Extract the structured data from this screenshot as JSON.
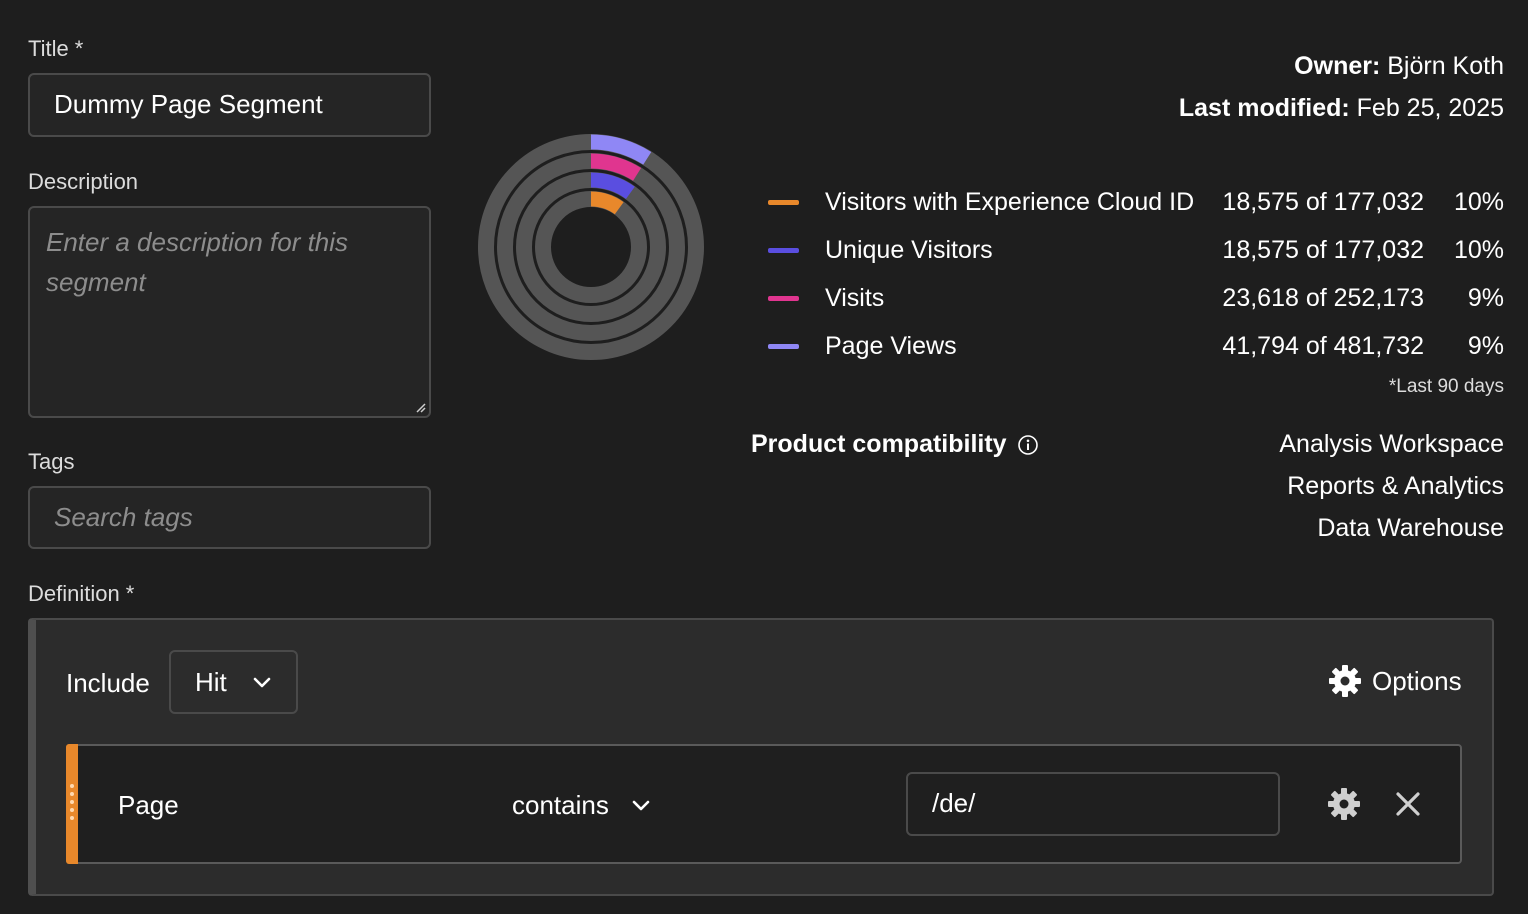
{
  "form": {
    "title_label": "Title",
    "required_mark": "*",
    "title_value": "Dummy Page Segment",
    "description_label": "Description",
    "description_placeholder": "Enter a description for this segment",
    "tags_label": "Tags",
    "tags_placeholder": "Search tags",
    "definition_label": "Definition"
  },
  "meta": {
    "owner_label": "Owner:",
    "owner_value": "Björn Koth",
    "modified_label": "Last modified:",
    "modified_value": "Feb 25, 2025"
  },
  "stats": {
    "rows": [
      {
        "name": "Visitors with Experience Cloud ID",
        "count": "18,575 of 177,032",
        "pct": "10%",
        "color": "#e8882b",
        "fraction": 0.1
      },
      {
        "name": "Unique Visitors",
        "count": "18,575 of 177,032",
        "pct": "10%",
        "color": "#5a4ee0",
        "fraction": 0.1
      },
      {
        "name": "Visits",
        "count": "23,618 of 252,173",
        "pct": "9%",
        "color": "#e0358f",
        "fraction": 0.09
      },
      {
        "name": "Page Views",
        "count": "41,794 of 481,732",
        "pct": "9%",
        "color": "#8f87f5",
        "fraction": 0.09
      }
    ],
    "footnote": "*Last 90 days",
    "track_color": "#555555"
  },
  "compat": {
    "label": "Product compatibility",
    "info_icon": "info-icon",
    "products": [
      "Analysis Workspace",
      "Reports & Analytics",
      "Data Warehouse"
    ]
  },
  "definition": {
    "include_label": "Include",
    "scope_value": "Hit",
    "options_label": "Options",
    "rule": {
      "dimension": "Page",
      "operator": "contains",
      "value": "/de/"
    }
  }
}
